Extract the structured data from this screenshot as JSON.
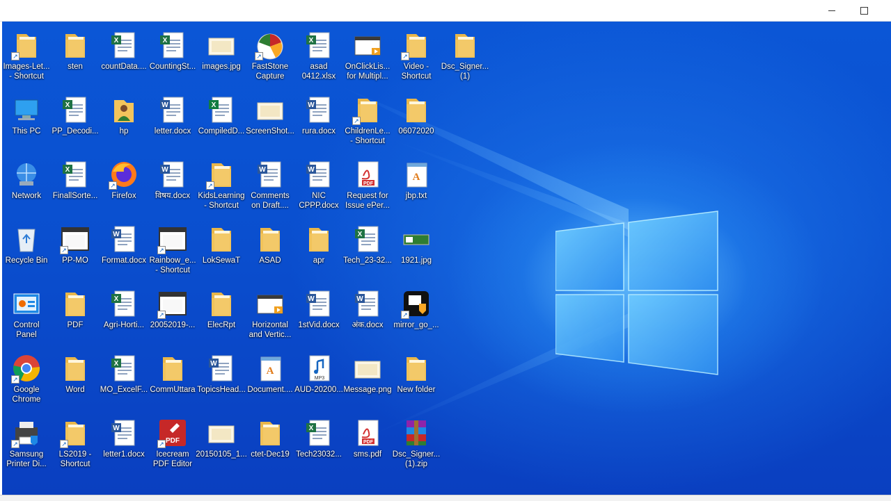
{
  "window": {
    "minimize_label": "",
    "maximize_label": ""
  },
  "desktop": {
    "icons": [
      {
        "label": "Images-Let...\n- Shortcut",
        "icon": "folder-icon",
        "shortcut": true,
        "col": 0,
        "row": 0
      },
      {
        "label": "sten",
        "icon": "folder-icon",
        "shortcut": false,
        "col": 1,
        "row": 0
      },
      {
        "label": "countData....",
        "icon": "excel-icon",
        "shortcut": false,
        "col": 2,
        "row": 0
      },
      {
        "label": "CountingSt...",
        "icon": "excel-icon",
        "shortcut": false,
        "col": 3,
        "row": 0
      },
      {
        "label": "images.jpg",
        "icon": "image-icon",
        "shortcut": false,
        "col": 4,
        "row": 0
      },
      {
        "label": "FastStone\nCapture",
        "icon": "faststone-icon",
        "shortcut": true,
        "col": 5,
        "row": 0
      },
      {
        "label": "asad\n0412.xlsx",
        "icon": "excel-icon",
        "shortcut": false,
        "col": 6,
        "row": 0
      },
      {
        "label": "OnClickLis...\nfor Multipl...",
        "icon": "video-icon",
        "shortcut": false,
        "col": 7,
        "row": 0
      },
      {
        "label": "Video -\nShortcut",
        "icon": "folder-icon",
        "shortcut": true,
        "col": 8,
        "row": 0
      },
      {
        "label": "Dsc_Signer...\n(1)",
        "icon": "folder-icon",
        "shortcut": false,
        "col": 9,
        "row": 0
      },
      {
        "label": "This PC",
        "icon": "pc-icon",
        "shortcut": false,
        "col": 0,
        "row": 1
      },
      {
        "label": "PP_Decodi...",
        "icon": "excel-icon",
        "shortcut": false,
        "col": 1,
        "row": 1
      },
      {
        "label": "hp",
        "icon": "user-folder-icon",
        "shortcut": false,
        "col": 2,
        "row": 1
      },
      {
        "label": "letter.docx",
        "icon": "word-icon",
        "shortcut": false,
        "col": 3,
        "row": 1
      },
      {
        "label": "CompiledD...",
        "icon": "excel-green-icon",
        "shortcut": false,
        "col": 4,
        "row": 1
      },
      {
        "label": "ScreenShot...",
        "icon": "image-icon",
        "shortcut": false,
        "col": 5,
        "row": 1
      },
      {
        "label": "rura.docx",
        "icon": "word-icon",
        "shortcut": false,
        "col": 6,
        "row": 1
      },
      {
        "label": "ChildrenLe...\n- Shortcut",
        "icon": "folder-icon",
        "shortcut": true,
        "col": 7,
        "row": 1
      },
      {
        "label": "06072020",
        "icon": "folder-icon",
        "shortcut": false,
        "col": 8,
        "row": 1
      },
      {
        "label": "Network",
        "icon": "network-icon",
        "shortcut": false,
        "col": 0,
        "row": 2
      },
      {
        "label": "FinallSorte...",
        "icon": "excel-icon",
        "shortcut": false,
        "col": 1,
        "row": 2
      },
      {
        "label": "Firefox",
        "icon": "firefox-icon",
        "shortcut": true,
        "col": 2,
        "row": 2
      },
      {
        "label": "विषय.docx",
        "icon": "word-icon",
        "shortcut": false,
        "col": 3,
        "row": 2
      },
      {
        "label": "KidsLearning\n- Shortcut",
        "icon": "folder-icon",
        "shortcut": true,
        "col": 4,
        "row": 2
      },
      {
        "label": "Comments\non Draft....",
        "icon": "word-icon",
        "shortcut": false,
        "col": 5,
        "row": 2
      },
      {
        "label": "NIC\nCPPP.docx",
        "icon": "word-icon",
        "shortcut": false,
        "col": 6,
        "row": 2
      },
      {
        "label": "Request for\nIssue ePer...",
        "icon": "pdf-icon",
        "shortcut": false,
        "col": 7,
        "row": 2
      },
      {
        "label": "jbp.txt",
        "icon": "text-icon",
        "shortcut": false,
        "col": 8,
        "row": 2
      },
      {
        "label": "Recycle Bin",
        "icon": "recycle-bin-icon",
        "shortcut": false,
        "col": 0,
        "row": 3
      },
      {
        "label": "PP-MO",
        "icon": "app-window-icon",
        "shortcut": true,
        "col": 1,
        "row": 3
      },
      {
        "label": "Format.docx",
        "icon": "word-icon",
        "shortcut": false,
        "col": 2,
        "row": 3
      },
      {
        "label": "Rainbow_e...\n- Shortcut",
        "icon": "app-window-icon",
        "shortcut": true,
        "col": 3,
        "row": 3
      },
      {
        "label": "LokSewaT",
        "icon": "folder-icon",
        "shortcut": false,
        "col": 4,
        "row": 3
      },
      {
        "label": "ASAD",
        "icon": "folder-icon",
        "shortcut": false,
        "col": 5,
        "row": 3
      },
      {
        "label": "apr",
        "icon": "folder-icon",
        "shortcut": false,
        "col": 6,
        "row": 3
      },
      {
        "label": "Tech_23-32...",
        "icon": "excel-icon",
        "shortcut": false,
        "col": 7,
        "row": 3
      },
      {
        "label": "1921.jpg",
        "icon": "image-green-icon",
        "shortcut": false,
        "col": 8,
        "row": 3
      },
      {
        "label": "Control\nPanel",
        "icon": "control-panel-icon",
        "shortcut": false,
        "col": 0,
        "row": 4
      },
      {
        "label": "PDF",
        "icon": "folder-icon",
        "shortcut": false,
        "col": 1,
        "row": 4
      },
      {
        "label": "Agri-Horti...",
        "icon": "excel-icon",
        "shortcut": false,
        "col": 2,
        "row": 4
      },
      {
        "label": "20052019-...",
        "icon": "app-window-icon",
        "shortcut": true,
        "col": 3,
        "row": 4
      },
      {
        "label": "ElecRpt",
        "icon": "folder-icon",
        "shortcut": false,
        "col": 4,
        "row": 4
      },
      {
        "label": "Horizontal\nand Vertic...",
        "icon": "video-icon",
        "shortcut": false,
        "col": 5,
        "row": 4
      },
      {
        "label": "1stVid.docx",
        "icon": "word-icon",
        "shortcut": false,
        "col": 6,
        "row": 4
      },
      {
        "label": "अंक.docx",
        "icon": "word-icon",
        "shortcut": false,
        "col": 7,
        "row": 4
      },
      {
        "label": "mirror_go_...",
        "icon": "shield-app-icon",
        "shortcut": true,
        "col": 8,
        "row": 4
      },
      {
        "label": "Google\nChrome",
        "icon": "chrome-icon",
        "shortcut": true,
        "col": 0,
        "row": 5
      },
      {
        "label": "Word",
        "icon": "folder-icon",
        "shortcut": false,
        "col": 1,
        "row": 5
      },
      {
        "label": "MO_ExcelF...",
        "icon": "excel-icon",
        "shortcut": false,
        "col": 2,
        "row": 5
      },
      {
        "label": "CommUttara",
        "icon": "folder-icon",
        "shortcut": false,
        "col": 3,
        "row": 5
      },
      {
        "label": "TopicsHead...",
        "icon": "word-icon",
        "shortcut": false,
        "col": 4,
        "row": 5
      },
      {
        "label": "Document....",
        "icon": "text-icon",
        "shortcut": false,
        "col": 5,
        "row": 5
      },
      {
        "label": "AUD-20200...",
        "icon": "mp3-icon",
        "shortcut": false,
        "col": 6,
        "row": 5
      },
      {
        "label": "Message.png",
        "icon": "image-icon",
        "shortcut": false,
        "col": 7,
        "row": 5
      },
      {
        "label": "New folder",
        "icon": "folder-icon",
        "shortcut": false,
        "col": 8,
        "row": 5
      },
      {
        "label": "Samsung\nPrinter Di...",
        "icon": "printer-icon",
        "shortcut": true,
        "col": 0,
        "row": 6
      },
      {
        "label": "LS2019 -\nShortcut",
        "icon": "folder-icon",
        "shortcut": true,
        "col": 1,
        "row": 6
      },
      {
        "label": "letter1.docx",
        "icon": "word-icon",
        "shortcut": false,
        "col": 2,
        "row": 6
      },
      {
        "label": "Icecream\nPDF Editor",
        "icon": "pdf-editor-icon",
        "shortcut": true,
        "col": 3,
        "row": 6
      },
      {
        "label": "20150105_1...",
        "icon": "image-icon",
        "shortcut": false,
        "col": 4,
        "row": 6
      },
      {
        "label": "ctet-Dec19",
        "icon": "folder-icon",
        "shortcut": false,
        "col": 5,
        "row": 6
      },
      {
        "label": "Tech23032...",
        "icon": "excel-icon",
        "shortcut": false,
        "col": 6,
        "row": 6
      },
      {
        "label": "sms.pdf",
        "icon": "pdf-icon",
        "shortcut": false,
        "col": 7,
        "row": 6
      },
      {
        "label": "Dsc_Signer...\n(1).zip",
        "icon": "winrar-icon",
        "shortcut": false,
        "col": 8,
        "row": 6
      }
    ]
  },
  "colors": {
    "wallpaper": "#0a4fcf",
    "logo_light": "#9fe3ff",
    "folder": "#f2c45c",
    "excel": "#1f7244",
    "word": "#2b579a",
    "pdf": "#d32f2f"
  }
}
